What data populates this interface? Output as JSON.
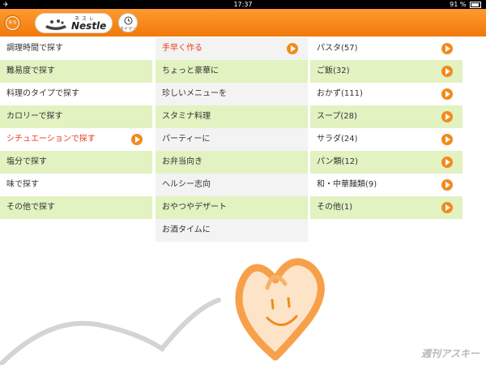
{
  "status_bar": {
    "time": "17:37",
    "battery": "91 %"
  },
  "toolbar": {
    "back_label": "戻る",
    "brand_kana": "ネスレ",
    "brand_name": "Nestle",
    "timer_label": "タイマー"
  },
  "menu_left": {
    "items": [
      {
        "label": "調理時間で探す"
      },
      {
        "label": "難易度で探す"
      },
      {
        "label": "料理のタイプで探す"
      },
      {
        "label": "カロリーで探す"
      },
      {
        "label": "シチュエーションで探す"
      },
      {
        "label": "塩分で探す"
      },
      {
        "label": "味で探す"
      },
      {
        "label": "その他で探す"
      }
    ],
    "selected_index": 4
  },
  "menu_middle": {
    "items": [
      {
        "label": "手早く作る"
      },
      {
        "label": "ちょっと豪華に"
      },
      {
        "label": "珍しいメニューを"
      },
      {
        "label": "スタミナ料理"
      },
      {
        "label": "パーティーに"
      },
      {
        "label": "お弁当向き"
      },
      {
        "label": "ヘルシー志向"
      },
      {
        "label": "おやつやデザート"
      },
      {
        "label": "お酒タイムに"
      }
    ],
    "selected_index": 0
  },
  "menu_right": {
    "items": [
      {
        "label": "パスタ(57)"
      },
      {
        "label": "ご飯(32)"
      },
      {
        "label": "おかず(111)"
      },
      {
        "label": "スープ(28)"
      },
      {
        "label": "サラダ(24)"
      },
      {
        "label": "パン類(12)"
      },
      {
        "label": "和・中華麺類(9)"
      },
      {
        "label": "その他(1)"
      }
    ]
  },
  "watermark": "週刊アスキー",
  "colors": {
    "accent": "#f28a1c",
    "row_green": "#e2f2c1",
    "selected_text": "#e8391c"
  },
  "icons": [
    "airplane-icon",
    "battery-icon",
    "back-icon",
    "nestle-nest-icon",
    "timer-icon",
    "arrow-right-icon",
    "heart-face-icon"
  ]
}
